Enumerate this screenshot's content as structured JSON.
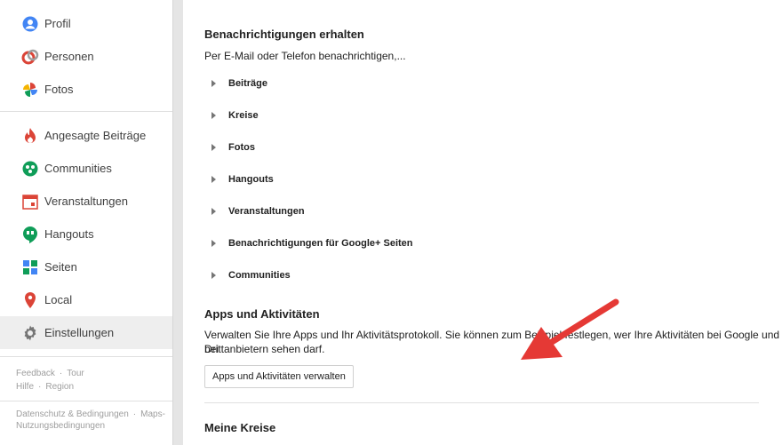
{
  "sidebar": {
    "items": [
      {
        "label": "Profil",
        "icon": "profile-icon"
      },
      {
        "label": "Personen",
        "icon": "people-icon"
      },
      {
        "label": "Fotos",
        "icon": "photos-icon"
      },
      {
        "label": "Angesagte Beiträge",
        "icon": "flame-icon"
      },
      {
        "label": "Communities",
        "icon": "communities-icon"
      },
      {
        "label": "Veranstaltungen",
        "icon": "calendar-icon"
      },
      {
        "label": "Hangouts",
        "icon": "hangouts-icon"
      },
      {
        "label": "Seiten",
        "icon": "pages-icon"
      },
      {
        "label": "Local",
        "icon": "location-pin-icon"
      },
      {
        "label": "Einstellungen",
        "icon": "gear-icon"
      }
    ],
    "footer": {
      "feedback": "Feedback",
      "tour": "Tour",
      "help": "Hilfe",
      "region": "Region",
      "privacy": "Datenschutz & Bedingungen",
      "maps": "Maps-",
      "maps_terms": "Nutzungsbedingungen"
    }
  },
  "notifications": {
    "title": "Benachrichtigungen erhalten",
    "desc": "Per E-Mail oder Telefon benachrichtigen,...",
    "rows": [
      "Beiträge",
      "Kreise",
      "Fotos",
      "Hangouts",
      "Veranstaltungen",
      "Benachrichtigungen für Google+ Seiten",
      "Communities"
    ]
  },
  "apps": {
    "title": "Apps und Aktivitäten",
    "desc_line1": "Verwalten Sie Ihre Apps und Ihr Aktivitätsprotokoll. Sie können zum Beispiel festlegen, wer Ihre Aktivitäten bei Google und bei",
    "desc_line2": "Drittanbietern sehen darf.",
    "button": "Apps und Aktivitäten verwalten"
  },
  "circles": {
    "title": "Meine Kreise"
  },
  "colors": {
    "arrow": "#e53935",
    "active_bg": "#eeeeee"
  }
}
